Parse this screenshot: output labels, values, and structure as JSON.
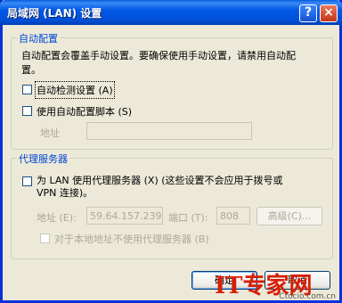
{
  "window": {
    "title": "局域网 (LAN) 设置",
    "help_glyph": "?",
    "close_glyph": "×"
  },
  "auto_config": {
    "group_title": "自动配置",
    "description_line1": "自动配置会覆盖手动设置。要确保使用手动设置，请禁用自动配",
    "description_line2": "置。",
    "auto_detect": {
      "label": "自动检测设置 (A)",
      "checked": false
    },
    "use_script": {
      "label": "使用自动配置脚本 (S)",
      "checked": false
    },
    "address_label": "地址",
    "address_value": ""
  },
  "proxy": {
    "group_title": "代理服务器",
    "use_proxy_line1": "为 LAN 使用代理服务器 (X) (这些设置不会应用于拨号或",
    "use_proxy_line2": "VPN 连接)。",
    "use_proxy_checked": false,
    "address_label": "地址 (E):",
    "address_value": "59.64.157.239",
    "port_label": "端口 (T):",
    "port_value": "808",
    "advanced_label": "高级(C)...",
    "bypass_local": {
      "label": "对于本地地址不使用代理服务器 (B)",
      "checked": false
    }
  },
  "buttons": {
    "ok": "确定",
    "cancel": "取消"
  },
  "watermark": {
    "logo": "IT专家网",
    "url": "Ctocio.com.cn"
  },
  "colors": {
    "titlebar": "#0058e6",
    "group_title": "#0046d5",
    "dialog_bg": "#ece9d8"
  }
}
